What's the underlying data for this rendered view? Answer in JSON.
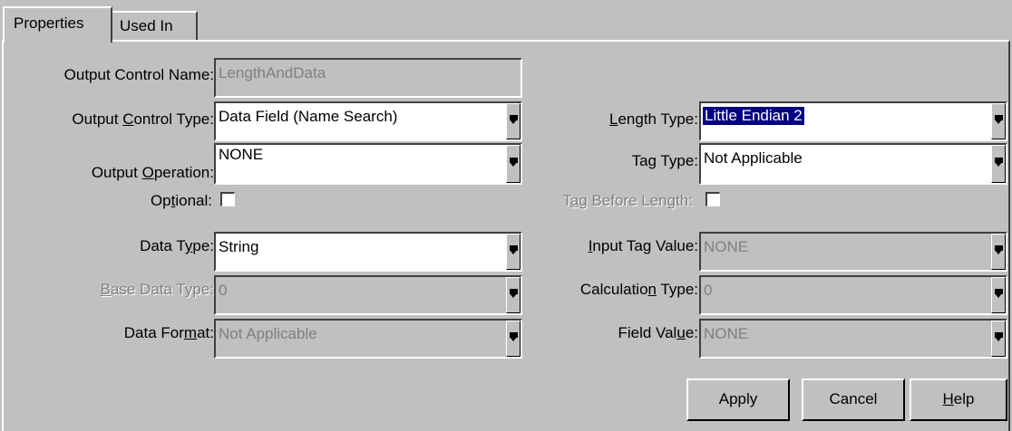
{
  "tabs": {
    "properties": "Properties",
    "used_in": "Used In"
  },
  "left": {
    "output_control_name": {
      "label": "Output Control Name:",
      "value": "LengthAndData"
    },
    "output_control_type": {
      "label_pre": "Output ",
      "label_u": "C",
      "label_post": "ontrol Type:",
      "value": "Data Field (Name Search)"
    },
    "output_operation": {
      "label_pre": "Output ",
      "label_u": "O",
      "label_post": "peration:",
      "value": "NONE"
    },
    "optional": {
      "label_pre": "Op",
      "label_u": "t",
      "label_post": "ional:"
    },
    "data_type": {
      "label_pre": "Data T",
      "label_u": "y",
      "label_post": "pe:",
      "value": "String"
    },
    "base_data_type": {
      "label_pre": "",
      "label_u": "B",
      "label_post": "ase Data Type:",
      "value": "0"
    },
    "data_format": {
      "label_pre": "Data For",
      "label_u": "m",
      "label_post": "at:",
      "value": "Not Applicable"
    }
  },
  "right": {
    "length_type": {
      "label_pre": "",
      "label_u": "L",
      "label_post": "ength Type:",
      "value": "Little Endian 2"
    },
    "tag_type": {
      "label_pre": "Ta",
      "label_u": "g",
      "label_post": " Type:",
      "value": "Not Applicable"
    },
    "tag_before_length": {
      "label_pre": "T",
      "label_u": "a",
      "label_post": "g Before Length:"
    },
    "input_tag_value": {
      "label_pre": "",
      "label_u": "I",
      "label_post": "nput Tag Value:",
      "value": "NONE"
    },
    "calculation_type": {
      "label_pre": "Calculatio",
      "label_u": "n",
      "label_post": " Type:",
      "value": "0"
    },
    "field_value": {
      "label_pre": "Field Val",
      "label_u": "u",
      "label_post": "e:",
      "value": "NONE"
    }
  },
  "buttons": {
    "apply": "Apply",
    "cancel": "Cancel",
    "help_u": "H",
    "help_post": "elp"
  }
}
